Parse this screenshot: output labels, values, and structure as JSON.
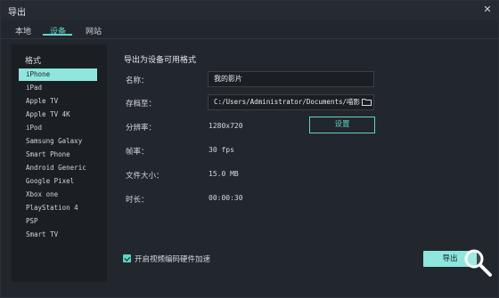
{
  "window": {
    "title": "导出",
    "close_label": "✕"
  },
  "tabs": [
    {
      "label": "本地",
      "active": false
    },
    {
      "label": "设备",
      "active": true
    },
    {
      "label": "网站",
      "active": false
    }
  ],
  "sidebar": {
    "header": "格式",
    "items": [
      {
        "label": "iPhone",
        "selected": true
      },
      {
        "label": "iPad",
        "selected": false
      },
      {
        "label": "Apple TV",
        "selected": false
      },
      {
        "label": "Apple TV 4K",
        "selected": false
      },
      {
        "label": "iPod",
        "selected": false
      },
      {
        "label": "Samsung Galaxy",
        "selected": false
      },
      {
        "label": "Smart Phone",
        "selected": false
      },
      {
        "label": "Android Generic",
        "selected": false
      },
      {
        "label": "Google Pixel",
        "selected": false
      },
      {
        "label": "Xbox one",
        "selected": false
      },
      {
        "label": "PlayStation 4",
        "selected": false
      },
      {
        "label": "PSP",
        "selected": false
      },
      {
        "label": "Smart TV",
        "selected": false
      }
    ]
  },
  "main": {
    "title": "导出为设备可用格式",
    "name_label": "名称：",
    "name_value": "我的影片",
    "path_label": "存档至：",
    "path_value": "C:/Users/Administrator/Documents/喵影",
    "resolution_label": "分辨率：",
    "resolution_value": "1280x720",
    "settings_button": "设置",
    "framerate_label": "帧率：",
    "framerate_value": "30 fps",
    "filesize_label": "文件大小：",
    "filesize_value": "15.0 MB",
    "duration_label": "时长：",
    "duration_value": "00:00:30"
  },
  "footer": {
    "hw_accel_label": "开启视频编码硬件加速",
    "hw_accel_checked": true,
    "export_button": "导出"
  },
  "colors": {
    "accent": "#5fd4c8",
    "accent_fill": "#8fe6dc",
    "background": "#22262d",
    "sidebar_bg": "#1b1e23"
  },
  "icons": {
    "folder": "folder-icon",
    "zoom": "magnifier-icon",
    "check": "checkmark-icon"
  }
}
